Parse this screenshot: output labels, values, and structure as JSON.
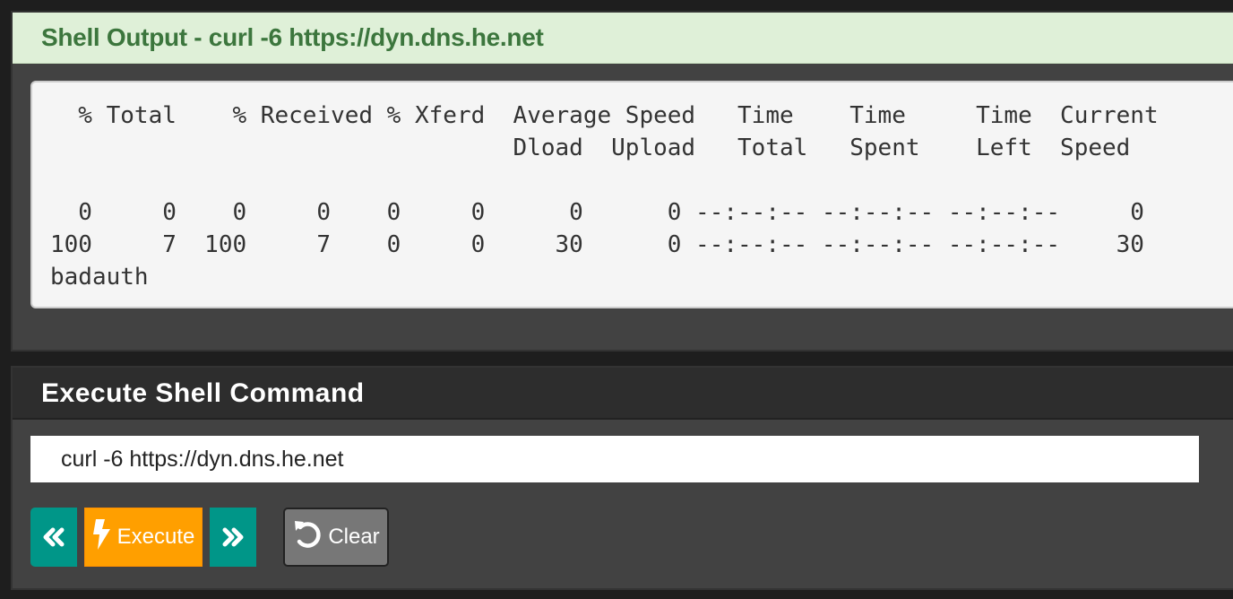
{
  "output_panel": {
    "title": "Shell Output - curl -6 https://dyn.dns.he.net",
    "output": "  % Total    % Received % Xferd  Average Speed   Time    Time     Time  Current\n                                 Dload  Upload   Total   Spent    Left  Speed\n\n  0     0    0     0    0     0      0      0 --:--:-- --:--:-- --:--:--     0\n100     7  100     7    0     0     30      0 --:--:-- --:--:-- --:--:--    30\nbadauth"
  },
  "command_panel": {
    "title": "Execute Shell Command",
    "command_value": "curl -6 https://dyn.dns.he.net",
    "buttons": {
      "previous_icon": "angle-double-left-icon",
      "execute": "Execute",
      "execute_icon": "bolt-icon",
      "next_icon": "angle-double-right-icon",
      "clear": "Clear",
      "clear_icon": "undo-icon"
    }
  },
  "colors": {
    "execute": "#ff9f00",
    "history": "#009688",
    "clear": "#777777",
    "success_header": "#dff0d8"
  }
}
